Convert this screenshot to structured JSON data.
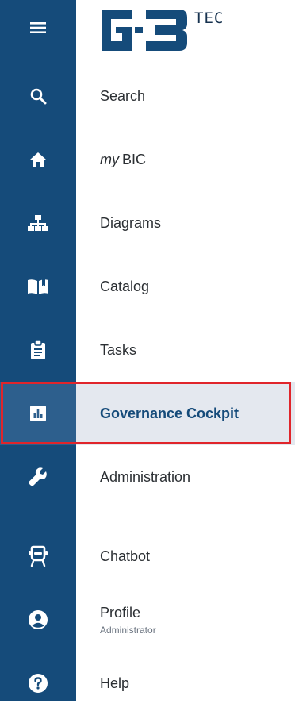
{
  "brand": {
    "text": "TEC"
  },
  "menu_icon": "hamburger-icon",
  "nav": [
    {
      "key": "search",
      "icon": "search-icon",
      "label": "Search"
    },
    {
      "key": "mybic",
      "icon": "home-icon",
      "label_em": "my",
      "label": "BIC"
    },
    {
      "key": "diagrams",
      "icon": "sitemap-icon",
      "label": "Diagrams"
    },
    {
      "key": "catalog",
      "icon": "book-open-icon",
      "label": "Catalog"
    },
    {
      "key": "tasks",
      "icon": "clipboard-icon",
      "label": "Tasks"
    },
    {
      "key": "governance",
      "icon": "chart-box-icon",
      "label": "Governance Cockpit",
      "active": true
    },
    {
      "key": "administration",
      "icon": "wrench-icon",
      "label": "Administration"
    },
    {
      "key": "chatbot",
      "icon": "robot-icon",
      "label": "Chatbot"
    },
    {
      "key": "profile",
      "icon": "user-circle-icon",
      "label": "Profile",
      "sublabel": "Administrator"
    },
    {
      "key": "help",
      "icon": "help-circle-icon",
      "label": "Help"
    }
  ],
  "colors": {
    "rail": "#154b7a",
    "active_bg": "#e4e8ef",
    "highlight": "#e0252b"
  }
}
